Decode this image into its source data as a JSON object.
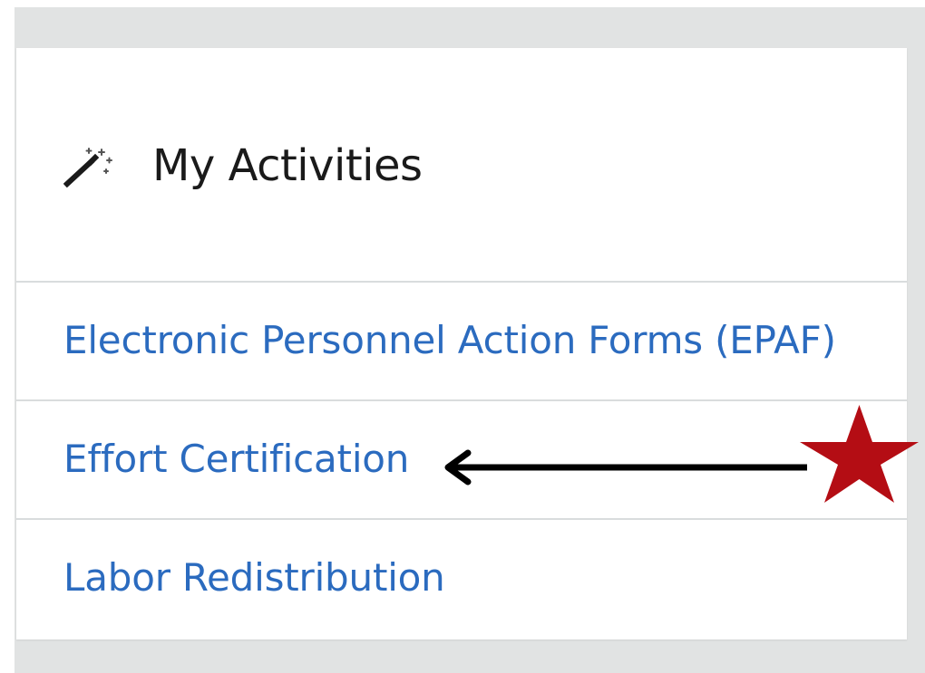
{
  "panel": {
    "header": {
      "title": "My Activities",
      "icon": "magic-wand-icon"
    },
    "items": [
      {
        "label": "Electronic Personnel Action Forms (EPAF)"
      },
      {
        "label": "Effort Certification"
      },
      {
        "label": "Labor Redistribution"
      }
    ]
  },
  "annotations": {
    "highlighted_item": "Effort Certification",
    "arrow_color": "#000000",
    "star_color": "#b40d14"
  },
  "colors": {
    "link": "#2b6bbf",
    "title": "#1a1a1a",
    "backdrop": "#e1e3e3",
    "divider": "#d9dcdd"
  }
}
